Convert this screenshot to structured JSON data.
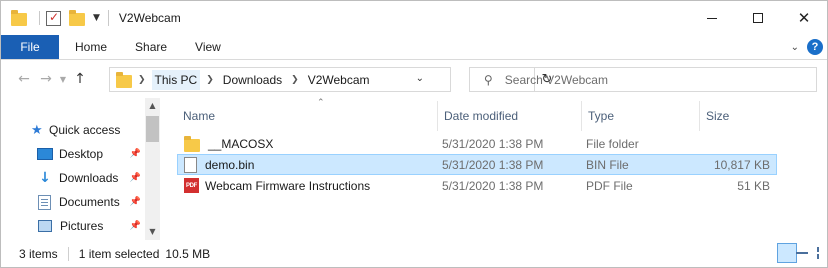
{
  "window": {
    "title": "V2Webcam"
  },
  "window_controls": {
    "minimize": "minimize-icon",
    "maximize": "maximize-icon",
    "close": "close-icon"
  },
  "ribbon": {
    "file": "File",
    "tabs": [
      "Home",
      "Share",
      "View"
    ],
    "file_color": "#1a5fb4"
  },
  "address": {
    "crumbs": [
      "This PC",
      "Downloads",
      "V2Webcam"
    ]
  },
  "search": {
    "placeholder": "Search V2Webcam"
  },
  "nav": {
    "items": [
      {
        "label": "Quick access",
        "icon": "star-icon"
      },
      {
        "label": "Desktop",
        "icon": "desktop-icon",
        "pinned": true
      },
      {
        "label": "Downloads",
        "icon": "download-icon",
        "pinned": true
      },
      {
        "label": "Documents",
        "icon": "documents-icon",
        "pinned": true
      },
      {
        "label": "Pictures",
        "icon": "pictures-icon",
        "pinned": true
      }
    ]
  },
  "columns": {
    "name": "Name",
    "date": "Date modified",
    "type": "Type",
    "size": "Size"
  },
  "files": [
    {
      "name": "__MACOSX",
      "date": "5/31/2020 1:38 PM",
      "type": "File folder",
      "size": "",
      "icon": "folder-icon",
      "selected": false
    },
    {
      "name": "demo.bin",
      "date": "5/31/2020 1:38 PM",
      "type": "BIN File",
      "size": "10,817 KB",
      "icon": "file-icon",
      "selected": true
    },
    {
      "name": "Webcam Firmware Instructions",
      "date": "5/31/2020 1:38 PM",
      "type": "PDF File",
      "size": "51 KB",
      "icon": "pdf-icon",
      "selected": false
    }
  ],
  "pdf_badge": "PDF",
  "status": {
    "items": "3 items",
    "selected": "1 item selected",
    "size": "10.5 MB"
  }
}
